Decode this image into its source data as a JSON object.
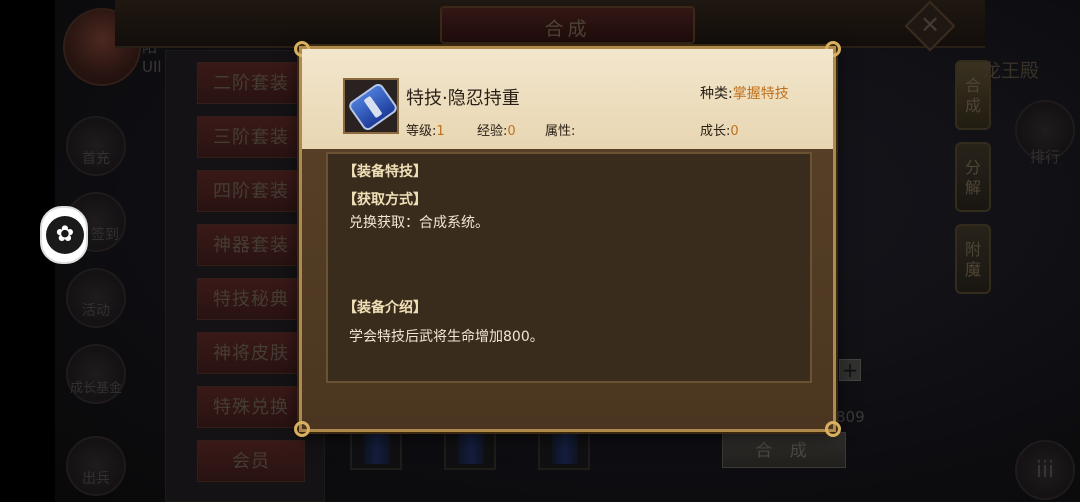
{
  "header": {
    "title": "合成",
    "close_symbol": "✕"
  },
  "player": {
    "name_fragments": [
      "阳",
      "UIl"
    ]
  },
  "left_icons": [
    {
      "label": "首充"
    },
    {
      "label": "签到"
    },
    {
      "label": "活动"
    },
    {
      "label": "成长基金"
    },
    {
      "label": "出兵"
    }
  ],
  "categories": [
    "二阶套装",
    "三阶套装",
    "四阶套装",
    "神器套装",
    "特技秘典",
    "神将皮肤",
    "特殊兑换",
    "会员"
  ],
  "side_tabs": [
    {
      "label": "合成",
      "active": true
    },
    {
      "label": "分解",
      "active": false
    },
    {
      "label": "附魔",
      "active": false
    }
  ],
  "right_panel": {
    "label": "龙王殿",
    "rank_label": "排行",
    "menu_symbol": "iii"
  },
  "compose": {
    "plus": "+",
    "count": "809",
    "button_label": "合 成"
  },
  "overlay": {
    "symbol": "✿"
  },
  "modal": {
    "item_name": "特技·隐忍持重",
    "type_label": "种类:",
    "type_value": "掌握特技",
    "stats": [
      {
        "label": "等级:",
        "value": "1"
      },
      {
        "label": "经验:",
        "value": "0"
      },
      {
        "label": "属性:",
        "value": ""
      },
      {
        "label": "成长:",
        "value": "0"
      }
    ],
    "sections": {
      "equip_skill_title": "【装备特技】",
      "acquire_title": "【获取方式】",
      "acquire_text": "兑换获取：合成系统。",
      "intro_title": "【装备介绍】",
      "intro_text": "学会特技后武将生命增加800。"
    }
  }
}
